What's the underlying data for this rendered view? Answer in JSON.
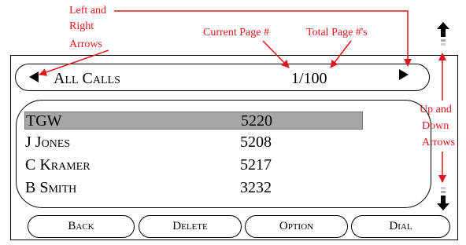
{
  "annotations": {
    "left_right_arrows": [
      "Left and",
      "Right",
      "Arrows"
    ],
    "current_page": "Current Page #",
    "total_pages": "Total Page #'s",
    "up_down_arrows": [
      "Up and",
      "Down",
      "Arrows"
    ]
  },
  "screen": {
    "title": "All Calls",
    "page": "1/100",
    "rows": [
      {
        "name": "TGW",
        "ext": "5220",
        "selected": true
      },
      {
        "name": "J Jones",
        "ext": "5208",
        "selected": false
      },
      {
        "name": "C Kramer",
        "ext": "5217",
        "selected": false
      },
      {
        "name": "B Smith",
        "ext": "3232",
        "selected": false
      }
    ],
    "softkeys": [
      "Back",
      "Delete",
      "Option",
      "Dial"
    ]
  },
  "icons": {
    "left": "left-triangle-arrow",
    "right": "right-triangle-arrow",
    "up": "up-arrow",
    "down": "down-arrow"
  },
  "colors": {
    "annotation": "#e8141c",
    "selection": "#a6a6a6",
    "outline": "#000000"
  }
}
